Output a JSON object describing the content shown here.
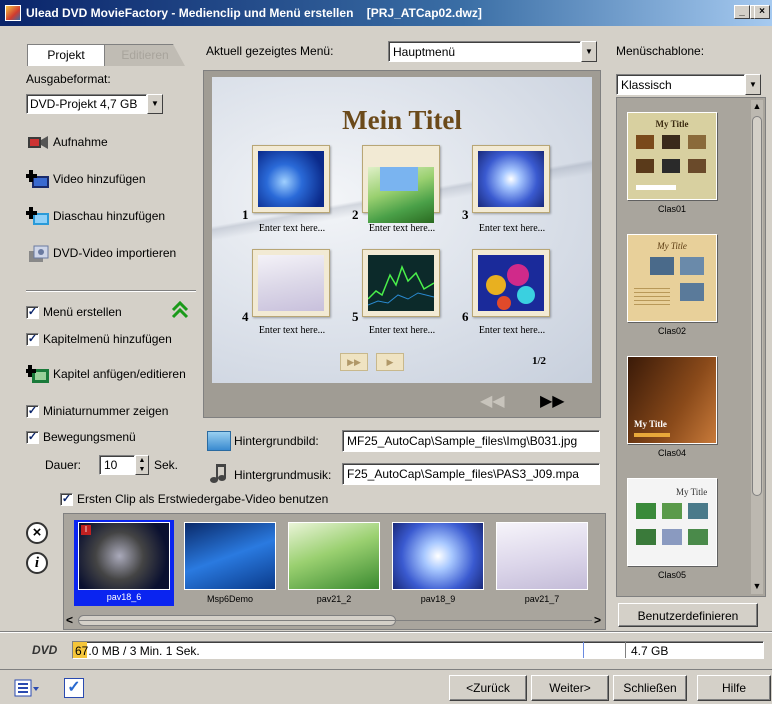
{
  "window": {
    "title": "Ulead DVD MovieFactory - Medienclip und Menü erstellen",
    "project_file": "[PRJ_ATCap02.dwz]",
    "controls": [
      "_",
      "□",
      "×"
    ]
  },
  "tabs": {
    "projekt": "Projekt",
    "editieren": "Editieren"
  },
  "output_format": {
    "label": "Ausgabeformat:",
    "value": "DVD-Projekt 4,7 GB"
  },
  "actions": {
    "aufnahme": "Aufnahme",
    "video_hinzufuegen": "Video hinzufügen",
    "diaschau_hinzufuegen": "Diaschau hinzufügen",
    "dvd_video_importieren": "DVD-Video importieren"
  },
  "options": {
    "menu_erstellen": "Menü erstellen",
    "kapitelmenu": "Kapitelmenü hinzufügen",
    "kapitel_anfuegen": "Kapitel anfügen/editieren",
    "miniaturnummer": "Miniaturnummer zeigen",
    "bewegungsmenu": "Bewegungsmenü",
    "dauer_label": "Dauer:",
    "dauer_value": "10",
    "dauer_unit": "Sek.",
    "erstwiedergabe": "Ersten Clip als Erstwiedergabe-Video benutzen"
  },
  "menu_select": {
    "label": "Aktuell gezeigtes Menü:",
    "value": "Hauptmenü"
  },
  "template_select": {
    "label": "Menüschablone:",
    "value": "Klassisch"
  },
  "preview": {
    "title": "Mein Titel",
    "numbers": [
      "1",
      "2",
      "3",
      "4",
      "5",
      "6"
    ],
    "captions": [
      "Enter text here...",
      "Enter text here...",
      "Enter text here...",
      "Enter text here...",
      "Enter text here...",
      "Enter text here..."
    ],
    "page": "1/2"
  },
  "background": {
    "image_label": "Hintergrundbild:",
    "image_value": "MF25_AutoCap\\Sample_files\\Img\\B031.jpg",
    "music_label": "Hintergrundmusik:",
    "music_value": "F25_AutoCap\\Sample_files\\PAS3_J09.mpa"
  },
  "templates": [
    "Clas01",
    "Clas02",
    "Clas04",
    "Clas05"
  ],
  "template_text": {
    "my_title": "My Title"
  },
  "benutzerdefiniert": "Benutzerdefinieren",
  "clips": [
    "pav18_6",
    "Msp6Demo",
    "pav21_2",
    "pav18_9",
    "pav21_7"
  ],
  "status": {
    "disc": "DVD",
    "used_highlight": "67",
    "used_rest": ".0 MB / 3 Min. 1 Sek.",
    "capacity": "4.7 GB",
    "fraction": 0.014
  },
  "buttons": {
    "zurueck": "<Zurück",
    "weiter": "Weiter>",
    "schliessen": "Schließen",
    "hilfe": "Hilfe"
  },
  "colors": {
    "title_gradient_start": "#0a246a",
    "selection": "#0a24f0",
    "status_highlight": "#f5c63a",
    "menu_title": "#6b4a1a"
  }
}
